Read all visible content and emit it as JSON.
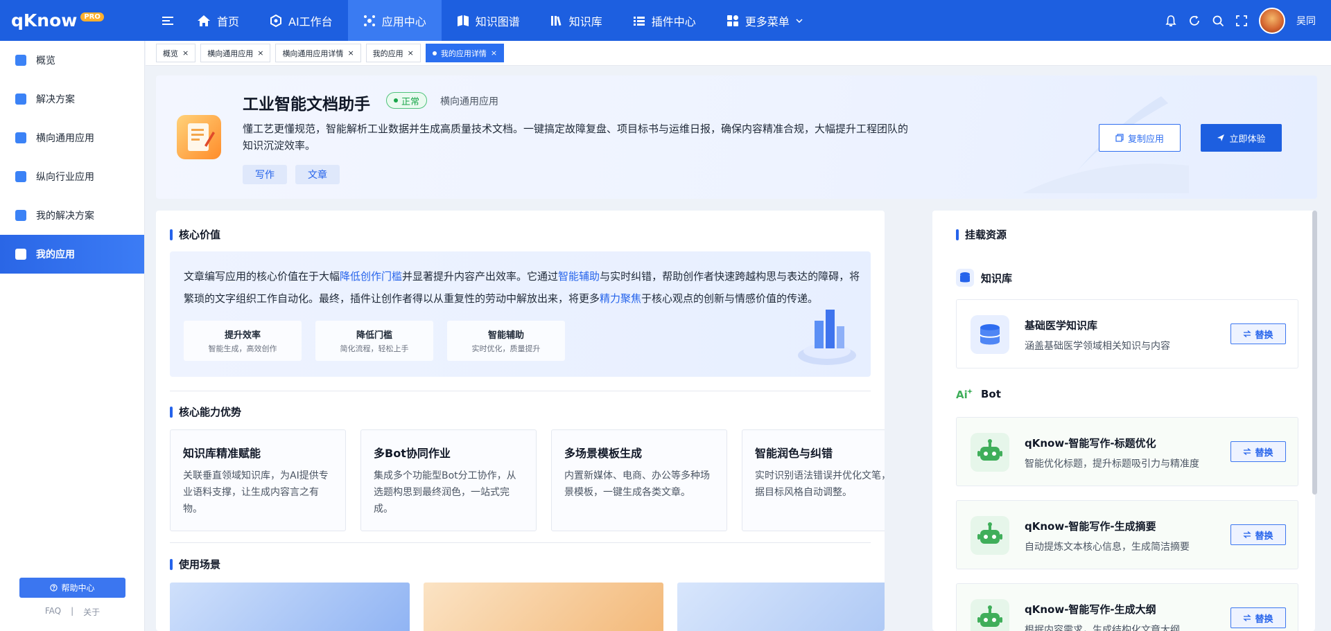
{
  "header": {
    "logo": "qKnow",
    "logo_badge": "PRO",
    "nav": [
      {
        "label": "首页",
        "icon": "home-icon"
      },
      {
        "label": "AI工作台",
        "icon": "cube-icon"
      },
      {
        "label": "应用中心",
        "icon": "apps-icon"
      },
      {
        "label": "知识图谱",
        "icon": "graph-icon"
      },
      {
        "label": "知识库",
        "icon": "books-icon"
      },
      {
        "label": "插件中心",
        "icon": "plugin-icon"
      },
      {
        "label": "更多菜单",
        "icon": "grid-icon"
      }
    ],
    "user_name": "吴同"
  },
  "sidebar": {
    "items": [
      {
        "label": "概览"
      },
      {
        "label": "解决方案"
      },
      {
        "label": "横向通用应用"
      },
      {
        "label": "纵向行业应用"
      },
      {
        "label": "我的解决方案"
      },
      {
        "label": "我的应用"
      }
    ],
    "help_label": "帮助中心",
    "faq_label": "FAQ",
    "sep": "|",
    "about_label": "关于"
  },
  "tabs": [
    {
      "label": "概览"
    },
    {
      "label": "横向通用应用"
    },
    {
      "label": "横向通用应用详情"
    },
    {
      "label": "我的应用"
    },
    {
      "label": "我的应用详情"
    }
  ],
  "hero": {
    "title": "工业智能文档助手",
    "status": "正常",
    "category": "横向通用应用",
    "description": "懂工艺更懂规范，智能解析工业数据并生成高质量技术文档。一键搞定故障复盘、项目标书与运维日报，确保内容精准合规，大幅提升工程团队的知识沉淀效率。",
    "tags": [
      "写作",
      "文章"
    ],
    "copy_label": "复制应用",
    "try_label": "立即体验"
  },
  "core_value": {
    "title": "核心价值",
    "text_1": "文章编写应用的核心价值在于大幅",
    "hl_1": "降低创作门槛",
    "text_2": "并显著提升内容产出效率。它通过",
    "hl_2": "智能辅助",
    "text_3": "与实时纠错，帮助创作者快速跨越构思与表达的障碍，将繁琐的文字组织工作自动化。最终，插件让创作者得以从重复性的劳动中解放出来，将更多",
    "hl_3": "精力聚焦",
    "text_4": "于核心观点的创新与情感价值的传递。",
    "cards": [
      {
        "title": "提升效率",
        "sub": "智能生成，高效创作"
      },
      {
        "title": "降低门槛",
        "sub": "简化流程，轻松上手"
      },
      {
        "title": "智能辅助",
        "sub": "实时优化，质量提升"
      }
    ]
  },
  "capabilities": {
    "title": "核心能力优势",
    "items": [
      {
        "title": "知识库精准赋能",
        "desc": "关联垂直领域知识库，为AI提供专业语料支撑，让生成内容言之有物。"
      },
      {
        "title": "多Bot协同作业",
        "desc": "集成多个功能型Bot分工协作，从选题构思到最终润色，一站式完成。"
      },
      {
        "title": "多场景模板生成",
        "desc": "内置新媒体、电商、办公等多种场景模板，一键生成各类文章。"
      },
      {
        "title": "智能润色与纠错",
        "desc": "实时识别语法错误并优化文笔，根据目标风格自动调整。"
      }
    ]
  },
  "scenarios": {
    "title": "使用场景"
  },
  "resources": {
    "title": "挂载资源",
    "kb_group": "知识库",
    "bot_group": "Bot",
    "kb_items": [
      {
        "name": "基础医学知识库",
        "desc": "涵盖基础医学领域相关知识与内容",
        "action": "替换"
      }
    ],
    "bot_items": [
      {
        "name": "qKnow-智能写作-标题优化",
        "desc": "智能优化标题，提升标题吸引力与精准度",
        "action": "替换"
      },
      {
        "name": "qKnow-智能写作-生成摘要",
        "desc": "自动提炼文本核心信息，生成简洁摘要",
        "action": "替换"
      },
      {
        "name": "qKnow-智能写作-生成大纲",
        "desc": "根据内容需求，生成结构化文章大纲",
        "action": "替换"
      }
    ]
  },
  "colors": {
    "primary": "#1d5fe0",
    "accent": "#2563eb",
    "success": "#19a54a",
    "logo_badge": "#ffb02e"
  }
}
